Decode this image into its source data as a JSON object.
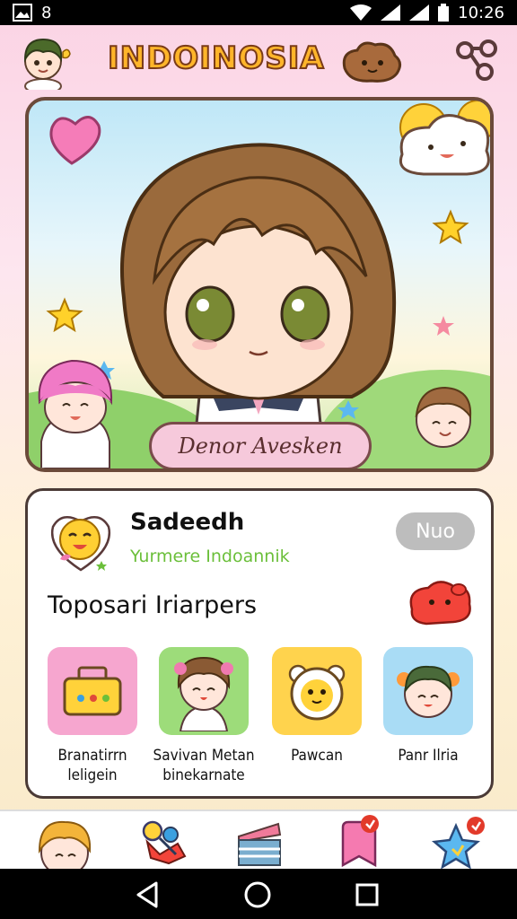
{
  "status_bar": {
    "time": "10:26",
    "left_glyph": "8"
  },
  "header": {
    "title": "INDOINOSIA"
  },
  "hero": {
    "button_label": "Denor Avesken"
  },
  "profile": {
    "name": "Sadeedh",
    "subtitle": "Yurmere Indoannik",
    "status_button": "Nuo"
  },
  "section": {
    "title": "Toposari Iriarpers",
    "items": [
      {
        "label_line1": "Branatirrn",
        "label_line2": "leligein",
        "icon": "toolbox-icon",
        "color": "#f6a6cf"
      },
      {
        "label_line1": "Savivan Metan",
        "label_line2": "binekarnate",
        "icon": "character-icon",
        "color": "#9ddc7a"
      },
      {
        "label_line1": "Pawcan",
        "label_line2": "",
        "icon": "bear-icon",
        "color": "#ffd34d"
      },
      {
        "label_line1": "Panr Ilria",
        "label_line2": "",
        "icon": "friend-icon",
        "color": "#a9dcf5"
      }
    ]
  },
  "colors": {
    "title": "#ffb52a",
    "subtitle": "#6bbf3a",
    "pill": "#f6c9db"
  }
}
